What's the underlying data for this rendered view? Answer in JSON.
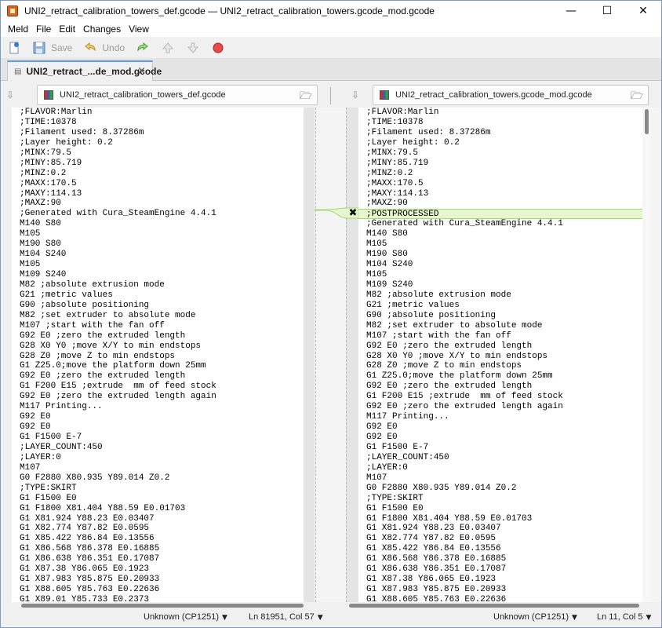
{
  "window": {
    "title": "UNI2_retract_calibration_towers_def.gcode — UNI2_retract_calibration_towers.gcode_mod.gcode",
    "controls": {
      "minimize": "—",
      "maximize": "☐",
      "close": "✕"
    }
  },
  "menu": [
    "Meld",
    "File",
    "Edit",
    "Changes",
    "View"
  ],
  "toolbar": {
    "new_icon": "new-comparison-icon",
    "save_label": "Save",
    "undo_label": "Undo"
  },
  "tab": {
    "label": "UNI2_retract_...de_mod.gcode",
    "close": "×"
  },
  "left_file": "UNI2_retract_calibration_towers_def.gcode",
  "right_file": "UNI2_retract_calibration_towers.gcode_mod.gcode",
  "left_lines": [
    ";FLAVOR:Marlin",
    ";TIME:10378",
    ";Filament used: 8.37286m",
    ";Layer height: 0.2",
    ";MINX:79.5",
    ";MINY:85.719",
    ";MINZ:0.2",
    ";MAXX:170.5",
    ";MAXY:114.13",
    ";MAXZ:90",
    ";Generated with Cura_SteamEngine 4.4.1",
    "M140 S80",
    "M105",
    "M190 S80",
    "M104 S240",
    "M105",
    "M109 S240",
    "M82 ;absolute extrusion mode",
    "G21 ;metric values",
    "G90 ;absolute positioning",
    "M82 ;set extruder to absolute mode",
    "M107 ;start with the fan off",
    "G92 E0 ;zero the extruded length",
    "G28 X0 Y0 ;move X/Y to min endstops",
    "G28 Z0 ;move Z to min endstops",
    "G1 Z25.0;move the platform down 25mm",
    "G92 E0 ;zero the extruded length",
    "G1 F200 E15 ;extrude  mm of feed stock",
    "G92 E0 ;zero the extruded length again",
    "M117 Printing...",
    "G92 E0",
    "G92 E0",
    "G1 F1500 E-7",
    ";LAYER_COUNT:450",
    ";LAYER:0",
    "M107",
    "G0 F2880 X80.935 Y89.014 Z0.2",
    ";TYPE:SKIRT",
    "G1 F1500 E0",
    "G1 F1800 X81.404 Y88.59 E0.01703",
    "G1 X81.924 Y88.23 E0.03407",
    "G1 X82.774 Y87.82 E0.0595",
    "G1 X85.422 Y86.84 E0.13556",
    "G1 X86.568 Y86.378 E0.16885",
    "G1 X86.638 Y86.351 E0.17087",
    "G1 X87.38 Y86.065 E0.1923",
    "G1 X87.983 Y85.875 E0.20933",
    "G1 X88.605 Y85.763 E0.22636",
    "G1 X89.01 Y85.733 E0.2373"
  ],
  "right_lines": [
    ";FLAVOR:Marlin",
    ";TIME:10378",
    ";Filament used: 8.37286m",
    ";Layer height: 0.2",
    ";MINX:79.5",
    ";MINY:85.719",
    ";MINZ:0.2",
    ";MAXX:170.5",
    ";MAXY:114.13",
    ";MAXZ:90",
    ";POSTPROCESSED",
    ";Generated with Cura_SteamEngine 4.4.1",
    "M140 S80",
    "M105",
    "M190 S80",
    "M104 S240",
    "M105",
    "M109 S240",
    "M82 ;absolute extrusion mode",
    "G21 ;metric values",
    "G90 ;absolute positioning",
    "M82 ;set extruder to absolute mode",
    "M107 ;start with the fan off",
    "G92 E0 ;zero the extruded length",
    "G28 X0 Y0 ;move X/Y to min endstops",
    "G28 Z0 ;move Z to min endstops",
    "G1 Z25.0;move the platform down 25mm",
    "G92 E0 ;zero the extruded length",
    "G1 F200 E15 ;extrude  mm of feed stock",
    "G92 E0 ;zero the extruded length again",
    "M117 Printing...",
    "G92 E0",
    "G92 E0",
    "G1 F1500 E-7",
    ";LAYER_COUNT:450",
    ";LAYER:0",
    "M107",
    "G0 F2880 X80.935 Y89.014 Z0.2",
    ";TYPE:SKIRT",
    "G1 F1500 E0",
    "G1 F1800 X81.404 Y88.59 E0.01703",
    "G1 X81.924 Y88.23 E0.03407",
    "G1 X82.774 Y87.82 E0.0595",
    "G1 X85.422 Y86.84 E0.13556",
    "G1 X86.568 Y86.378 E0.16885",
    "G1 X86.638 Y86.351 E0.17087",
    "G1 X87.38 Y86.065 E0.1923",
    "G1 X87.983 Y85.875 E0.20933",
    "G1 X88.605 Y85.763 E0.22636"
  ],
  "inserted_right_index": 10,
  "status": {
    "left_encoding": "Unknown (CP1251)",
    "left_position": "Ln 81951, Col 57",
    "right_encoding": "Unknown (CP1251)",
    "right_position": "Ln 11, Col 5"
  },
  "colors": {
    "insert_bg": "#e6f7d0",
    "insert_border": "#a6d870",
    "tab_accent": "#5d9bd8"
  }
}
